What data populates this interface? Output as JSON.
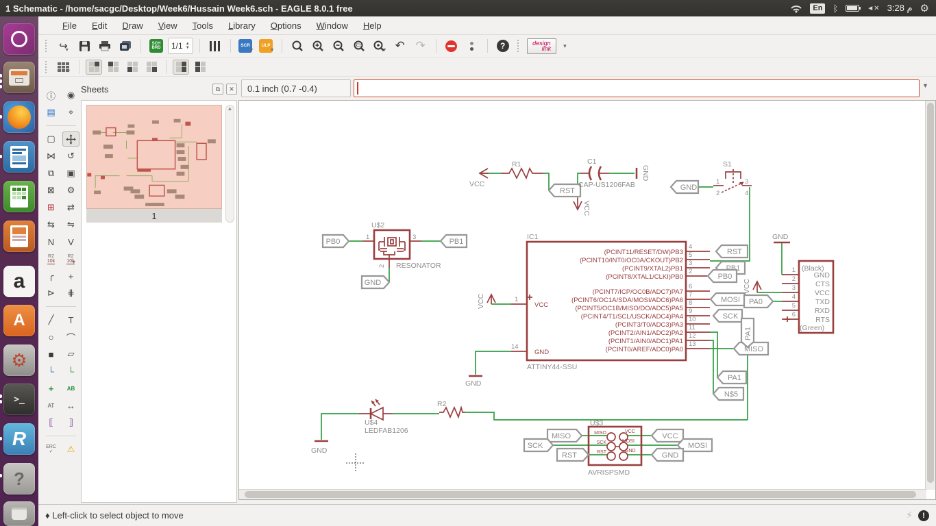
{
  "ui": {
    "title": "1 Schematic - /home/sacgc/Desktop/Week6/Hussain Week6.sch - EAGLE 8.0.1 free",
    "tray": {
      "en": "En",
      "clock": "م 3:28"
    },
    "menu": {
      "items": [
        "File",
        "Edit",
        "Draw",
        "View",
        "Tools",
        "Library",
        "Options",
        "Window",
        "Help"
      ]
    },
    "toolbar": {
      "pages": "1/1",
      "sch": "SCH",
      "brd": "BRD",
      "scr": "SCR",
      "ulp": "ULP",
      "design1": "design",
      "design2": "link",
      "help": "?"
    },
    "sheets": {
      "title": "Sheets",
      "page": "1"
    },
    "coords": "0.1 inch (0.7 -0.4)",
    "command": {
      "value": "",
      "placeholder": ""
    },
    "status": "♦ Left-click to select object to move"
  },
  "icons": {
    "caret": "▾",
    "open": "↪",
    "undo": "↶",
    "redo": "↷",
    "spin_up": "▲",
    "spin_down": "▼",
    "combo": "▼",
    "float": "⧉",
    "close": "✕",
    "info": "ⓘ",
    "show": "◉",
    "display": "▤",
    "mark": "⌖",
    "group": "▢",
    "mirror": "⋈",
    "rotate": "↺",
    "copy": "⧉",
    "paste": "▣",
    "delete": "⊠",
    "change": "⚙",
    "add": "⊞",
    "pinswap": "⇄",
    "gateswap": "⇆",
    "replace": "⇋",
    "name": "N",
    "value": "V",
    "smash_top": "R2",
    "smash_bot": "10k",
    "miter": "╭",
    "split": "+",
    "invoke": "⊳",
    "splitwire": "⋕",
    "wire": "╱",
    "text": "T",
    "circle": "○",
    "arc": "⌒",
    "rect": "■",
    "polygon": "▱",
    "bus": "└",
    "net": "└",
    "junction": "+",
    "label": "AB",
    "attribute": "AT",
    "dimension": "↔",
    "port1": "⟦",
    "port2": "⟧",
    "erc_top": "ERC",
    "erc_check": "✓",
    "warn": "⚠",
    "bt": "ᛒ",
    "mute": "◄✕",
    "gear": "⚙",
    "bolt": "⚡",
    "notif": "!",
    "amazon": "a",
    "r_app": "R",
    "help_app": "?",
    "terminal": ">_"
  },
  "schematic": {
    "power": {
      "vcc": "VCC",
      "gnd": "GND"
    },
    "r1": {
      "ref": "R1"
    },
    "r2": {
      "ref": "R2"
    },
    "c1": {
      "ref": "C1",
      "value": "CAP-US1206FAB"
    },
    "s1": {
      "ref": "S1",
      "pins": [
        "1",
        "2",
        "3",
        "4"
      ]
    },
    "u2": {
      "ref": "U$2",
      "value": "RESONATOR",
      "pins": [
        "1",
        "3",
        "2"
      ]
    },
    "u3": {
      "ref": "U$3",
      "value": "AVRISPSMD",
      "pads_left": [
        "MISO",
        "SCK",
        "RST"
      ],
      "pads_right": [
        "VCC",
        "MOSI",
        "GND"
      ]
    },
    "u4": {
      "ref": "U$4",
      "value": "LEDFAB1206"
    },
    "ic1": {
      "ref": "IC1",
      "value": "ATTINY44-SSU",
      "pin1": {
        "num": "1",
        "name": "VCC"
      },
      "pin14": {
        "num": "14",
        "name": "GND"
      },
      "right_pins": [
        {
          "num": "4",
          "name": "(PCINT11/RESET/DW)PB3"
        },
        {
          "num": "5",
          "name": "(PCINT10/INT0/OC0A/CKOUT)PB2"
        },
        {
          "num": "3",
          "name": "(PCINT9/XTAL2)PB1"
        },
        {
          "num": "2",
          "name": "(PCINT8/XTAL1/CLKI)PB0"
        },
        {
          "num": "6",
          "name": "(PCINT7/ICP/OC0B/ADC7)PA7"
        },
        {
          "num": "7",
          "name": "(PCINT6/OC1A/SDA/MOSI/ADC6)PA6"
        },
        {
          "num": "8",
          "name": "(PCINT5/OC1B/MISO/DO/ADC5)PA5"
        },
        {
          "num": "9",
          "name": "(PCINT4/T1/SCL/USCK/ADC4)PA4"
        },
        {
          "num": "10",
          "name": "(PCINT3/T0/ADC3)PA3"
        },
        {
          "num": "11",
          "name": "(PCINT2/AIN1/ADC2)PA2"
        },
        {
          "num": "12",
          "name": "(PCINT1/AIN0/ADC1)PA1"
        },
        {
          "num": "13",
          "name": "(PCINT0/AREF/ADC0)PA0"
        }
      ]
    },
    "ftdi": {
      "top": "(Black)",
      "bottom": "(Green)",
      "pins": [
        {
          "num": "1",
          "name": "GND"
        },
        {
          "num": "2",
          "name": "CTS"
        },
        {
          "num": "3",
          "name": "VCC"
        },
        {
          "num": "4",
          "name": "TXD"
        },
        {
          "num": "5",
          "name": "RXD"
        },
        {
          "num": "6",
          "name": "RTS"
        }
      ]
    },
    "tags": {
      "rst": "RST",
      "gnd": "GND",
      "pb0": "PB0",
      "pb1": "PB1",
      "mosi": "MOSI",
      "sck": "SCK",
      "miso": "MISO",
      "pa0": "PA0",
      "pa1": "PA1",
      "n5": "N$5",
      "vcc": "VCC"
    }
  },
  "colors": {
    "part": "#9a3e3e",
    "net": "#2f9e41",
    "label": "#8e8e8e",
    "accent": "#c4004f",
    "thumb_bg": "#f6cfc2"
  }
}
